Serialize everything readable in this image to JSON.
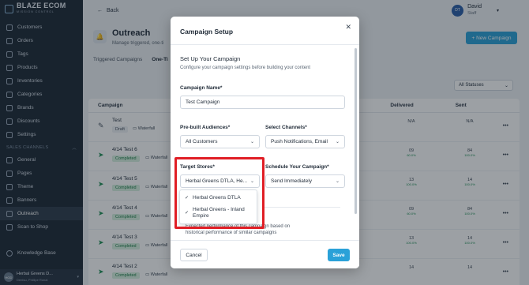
{
  "sidebar": {
    "brand": "BLAZE ECOM",
    "brand_sub": "MISSION CONTROL",
    "items": [
      {
        "label": "Customers"
      },
      {
        "label": "Orders"
      },
      {
        "label": "Tags"
      },
      {
        "label": "Products"
      },
      {
        "label": "Inventories"
      },
      {
        "label": "Categories"
      },
      {
        "label": "Brands"
      },
      {
        "label": "Discounts"
      },
      {
        "label": "Settings"
      }
    ],
    "section_title": "SALES CHANNELS",
    "channel_items": [
      {
        "label": "General"
      },
      {
        "label": "Pages"
      },
      {
        "label": "Theme"
      },
      {
        "label": "Banners"
      },
      {
        "label": "Outreach"
      },
      {
        "label": "Scan to Shop"
      }
    ],
    "knowledge": "Knowledge Base",
    "store": {
      "initials": "HGD",
      "name": "Herbal Greens D...",
      "sub": "Dentsu, Phillipe Ronal"
    }
  },
  "topbar": {
    "back_label": "Back",
    "user_initials": "DT",
    "user_name": "David",
    "user_role": "Staff"
  },
  "page": {
    "title": "Outreach",
    "subtitle": "Manage triggered, one-ti",
    "new_button": "+ New Campaign",
    "tabs": [
      "Triggered Campaigns",
      "One-Ti"
    ],
    "status_filter": "All Statuses"
  },
  "table": {
    "headers": [
      "Campaign",
      "Delivered",
      "Sent"
    ],
    "rows": [
      {
        "name": "Test",
        "status": "Draft",
        "channel": "Waterfall",
        "delivered": "N/A",
        "delivered_pct": "",
        "sent": "N/A",
        "sent_pct": ""
      },
      {
        "name": "4/14 Test 6",
        "status": "Completed",
        "channel": "Waterfall",
        "delivered": "09",
        "delivered_pct": "60.0%",
        "sent": "84",
        "sent_pct": "100.0%"
      },
      {
        "name": "4/14 Test 5",
        "status": "Completed",
        "channel": "Waterfall",
        "delivered": "13",
        "delivered_pct": "100.0%",
        "sent": "14",
        "sent_pct": "100.0%"
      },
      {
        "name": "4/14 Test 4",
        "status": "Completed",
        "channel": "Waterfall",
        "delivered": "09",
        "delivered_pct": "60.0%",
        "sent": "84",
        "sent_pct": "100.0%"
      },
      {
        "name": "4/14 Test 3",
        "status": "Completed",
        "channel": "Waterfall",
        "delivered": "13",
        "delivered_pct": "100.0%",
        "sent": "14",
        "sent_pct": "100.0%"
      },
      {
        "name": "4/14 Test 2",
        "status": "Completed",
        "channel": "Waterfall",
        "delivered": "14",
        "delivered_pct": "",
        "sent": "14",
        "sent_pct": ""
      }
    ]
  },
  "modal": {
    "title": "Campaign Setup",
    "section_title": "Set Up Your Campaign",
    "section_desc": "Configure your campaign settings before building your content",
    "name_label": "Campaign Name*",
    "name_value": "Test Campaign",
    "audience_label": "Pre-built Audiences*",
    "audience_value": "All Customers",
    "channels_label": "Select Channels*",
    "channels_value": "Push Notifications, Email",
    "stores_label": "Target Stores*",
    "stores_value": "Herbal Greens DTLA, He...",
    "schedule_label": "Schedule Your Campaign*",
    "schedule_value": "Send Immediately",
    "store_options": [
      "Herbal Greens DTLA",
      "Herbal Greens - Inland Empire"
    ],
    "performance_note": "Expected performance of this campaign based on historical performance of similar campaigns",
    "cancel_label": "Cancel",
    "save_label": "Save"
  },
  "colors": {
    "accent": "#2aa1d8",
    "highlight": "#e01e25",
    "sidebar": "#1d2835"
  }
}
